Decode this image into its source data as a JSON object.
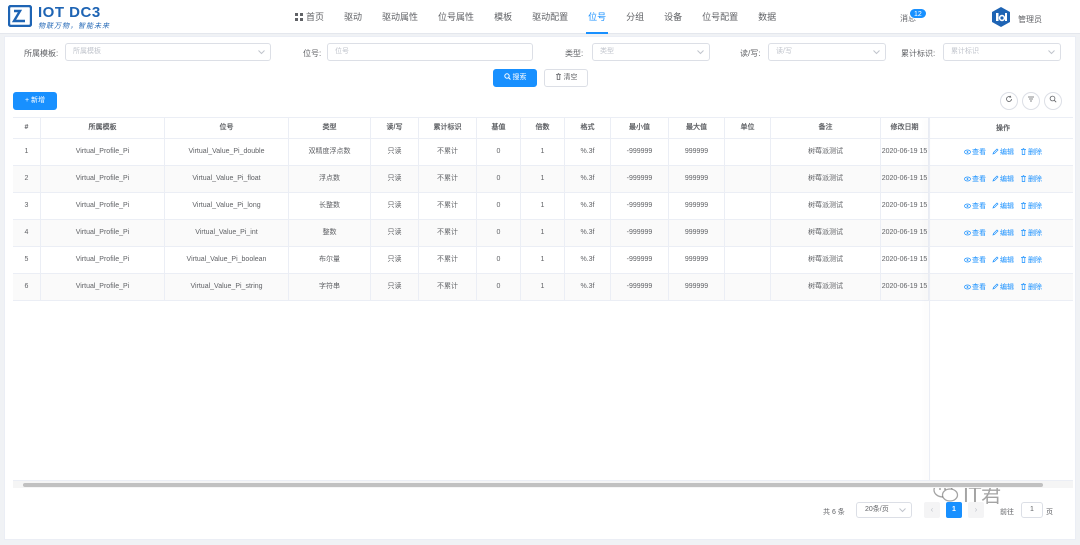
{
  "app": {
    "logo_title": "IOT DC3",
    "logo_subtitle": "物联万物，智能未来"
  },
  "nav": [
    {
      "label": "首页",
      "active": false
    },
    {
      "label": "驱动",
      "active": false
    },
    {
      "label": "驱动属性",
      "active": false
    },
    {
      "label": "位号属性",
      "active": false
    },
    {
      "label": "模板",
      "active": false
    },
    {
      "label": "驱动配置",
      "active": false
    },
    {
      "label": "位号",
      "active": true
    },
    {
      "label": "分组",
      "active": false
    },
    {
      "label": "设备",
      "active": false
    },
    {
      "label": "位号配置",
      "active": false
    },
    {
      "label": "数据",
      "active": false
    }
  ],
  "header": {
    "messages_label": "消息",
    "messages_count": "12",
    "user_name": "管理员"
  },
  "filters": {
    "profile_label": "所属模板:",
    "profile_placeholder": "所属模板",
    "point_label": "位号:",
    "point_placeholder": "位号",
    "type_label": "类型:",
    "type_placeholder": "类型",
    "rw_label": "读/写:",
    "rw_placeholder": "读/写",
    "accrue_label": "累计标识:",
    "accrue_placeholder": "累计标识",
    "search_label": "搜索",
    "reset_label": "清空"
  },
  "toolbar": {
    "add_label": "+ 新增"
  },
  "table": {
    "columns": [
      "#",
      "所属模板",
      "位号",
      "类型",
      "读/写",
      "累计标识",
      "基值",
      "倍数",
      "格式",
      "最小值",
      "最大值",
      "单位",
      "备注",
      "修改日期",
      "操作"
    ],
    "actions": {
      "view": "查看",
      "edit": "编辑",
      "delete": "删除"
    },
    "rows": [
      [
        "1",
        "Virtual_Profile_Pi",
        "Virtual_Value_Pi_double",
        "双精度浮点数",
        "只读",
        "不累计",
        "0",
        "1",
        "%.3f",
        "-999999",
        "999999",
        "",
        "树莓派测试",
        "2020-06-19 15"
      ],
      [
        "2",
        "Virtual_Profile_Pi",
        "Virtual_Value_Pi_float",
        "浮点数",
        "只读",
        "不累计",
        "0",
        "1",
        "%.3f",
        "-999999",
        "999999",
        "",
        "树莓派测试",
        "2020-06-19 15"
      ],
      [
        "3",
        "Virtual_Profile_Pi",
        "Virtual_Value_Pi_long",
        "长整数",
        "只读",
        "不累计",
        "0",
        "1",
        "%.3f",
        "-999999",
        "999999",
        "",
        "树莓派测试",
        "2020-06-19 15"
      ],
      [
        "4",
        "Virtual_Profile_Pi",
        "Virtual_Value_Pi_int",
        "整数",
        "只读",
        "不累计",
        "0",
        "1",
        "%.3f",
        "-999999",
        "999999",
        "",
        "树莓派测试",
        "2020-06-19 15"
      ],
      [
        "5",
        "Virtual_Profile_Pi",
        "Virtual_Value_Pi_boolean",
        "布尔量",
        "只读",
        "不累计",
        "0",
        "1",
        "%.3f",
        "-999999",
        "999999",
        "",
        "树莓派测试",
        "2020-06-19 15"
      ],
      [
        "6",
        "Virtual_Profile_Pi",
        "Virtual_Value_Pi_string",
        "字符串",
        "只读",
        "不累计",
        "0",
        "1",
        "%.3f",
        "-999999",
        "999999",
        "",
        "树莓派测试",
        "2020-06-19 15"
      ]
    ]
  },
  "pagination": {
    "total_label": "共 6 条",
    "page_size": "20条/页",
    "current_page": "1",
    "goto_label": "前往",
    "goto_value": "1",
    "page_suffix": "页"
  },
  "watermark": {
    "text": "IT君"
  },
  "colors": {
    "primary": "#1890ff",
    "logo": "#1e64b4"
  }
}
